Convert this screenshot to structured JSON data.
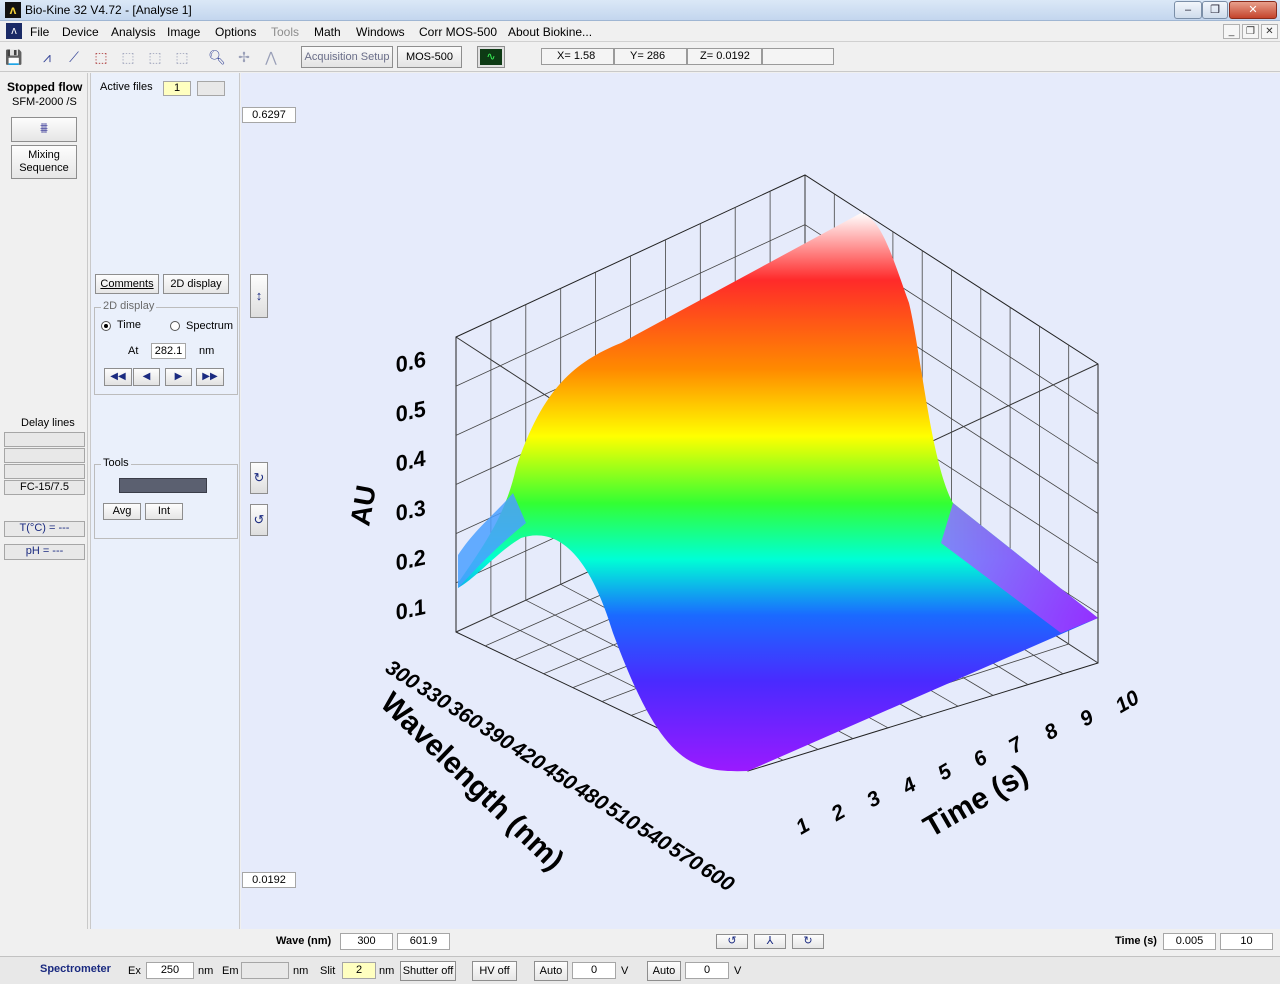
{
  "window": {
    "title": "Bio-Kine 32  V4.72 - [Analyse 1]",
    "app_icon": "biokine-logo-icon"
  },
  "menu": {
    "items": [
      "File",
      "Device",
      "Analysis",
      "Image",
      "Options",
      "Tools",
      "Math",
      "Windows",
      "Corr MOS-500",
      "About Biokine..."
    ],
    "disabled": [
      "Tools"
    ]
  },
  "toolbar": {
    "acquisition_setup": "Acquisition Setup",
    "mos500": "MOS-500",
    "readout_x": "X= 1.58",
    "readout_y": "Y= 286",
    "readout_z": "Z= 0.0192",
    "readout_extra": ""
  },
  "left": {
    "title": "Stopped flow",
    "device": "SFM-2000 /S",
    "mixing": "Mixing Sequence",
    "delay_lines": "Delay lines",
    "delay_values": [
      "",
      "",
      ""
    ],
    "fc": "FC-15/7.5",
    "temp": "T(°C) = ---",
    "ph": "pH = ---"
  },
  "controls": {
    "active_files_label": "Active files",
    "active_files_value": "1",
    "active_files_second": "",
    "comments": "Comments",
    "display_2d": "2D display",
    "group_2d_title": "2D display",
    "radio_time": "Time",
    "radio_spectrum": "Spectrum",
    "at_label": "At",
    "at_value": "282.1",
    "at_unit": "nm",
    "nav": [
      "◀◀",
      "◀",
      "▶",
      "▶▶"
    ],
    "tools_title": "Tools",
    "avg": "Avg",
    "int": "Int"
  },
  "plot": {
    "z_max": "0.6297",
    "z_min": "0.0192",
    "axis_z_label": "AU",
    "axis_x_label": "Wavelength (nm)",
    "axis_y_label": "Time (s)",
    "z_ticks": [
      "0.1",
      "0.2",
      "0.3",
      "0.4",
      "0.5",
      "0.6"
    ],
    "wave_ticks": [
      "300",
      "330",
      "360",
      "390",
      "420",
      "450",
      "480",
      "510",
      "540",
      "570",
      "600"
    ],
    "time_ticks": [
      "1",
      "2",
      "3",
      "4",
      "5",
      "6",
      "7",
      "8",
      "9",
      "10"
    ]
  },
  "bottom": {
    "wave_label": "Wave (nm)",
    "wave_from": "300",
    "wave_to": "601.9",
    "time_label": "Time (s)",
    "time_from": "0.005",
    "time_to": "10"
  },
  "status": {
    "spectrometer": "Spectrometer",
    "ex_label": "Ex",
    "ex_value": "250",
    "ex_unit": "nm",
    "em_label": "Em",
    "em_value": "",
    "em_unit": "nm",
    "slit_label": "Slit",
    "slit_value": "2",
    "slit_unit": "nm",
    "shutter": "Shutter off",
    "hv": "HV off",
    "auto1": "Auto",
    "v1_value": "0",
    "v1_unit": "V",
    "auto2": "Auto",
    "v2_value": "0",
    "v2_unit": "V"
  },
  "colors": {
    "plot_bg": "#e6ebfb",
    "panel_bg": "#eaf0fb",
    "accent": "#1a2a80"
  }
}
